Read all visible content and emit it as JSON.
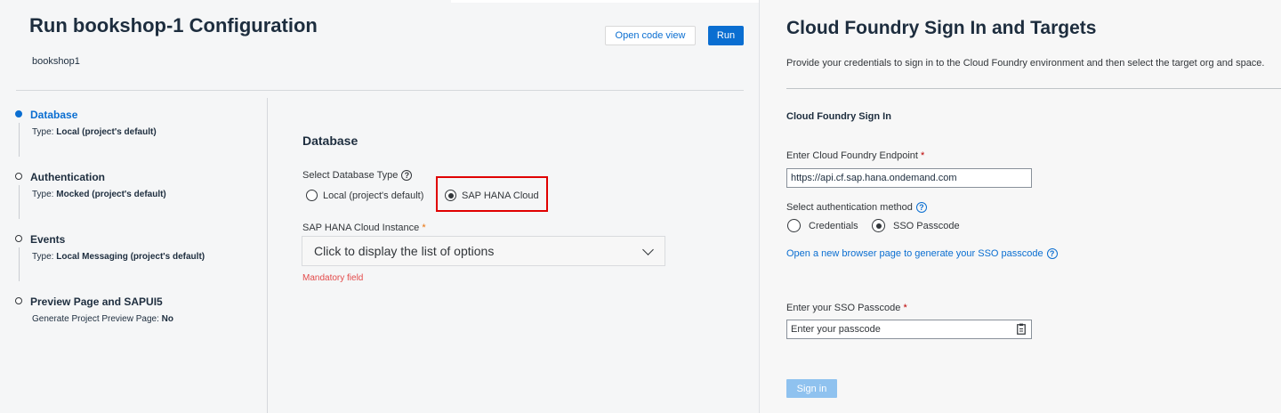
{
  "config": {
    "title": "Run bookshop-1 Configuration",
    "project": "bookshop1",
    "open_code_view_label": "Open code view",
    "run_label": "Run"
  },
  "steps": [
    {
      "title": "Database",
      "sub_label": "Type:",
      "sub_value": "Local (project's default)",
      "active": true
    },
    {
      "title": "Authentication",
      "sub_label": "Type:",
      "sub_value": "Mocked (project's default)",
      "active": false
    },
    {
      "title": "Events",
      "sub_label": "Type:",
      "sub_value": "Local Messaging (project's default)",
      "active": false
    },
    {
      "title": "Preview Page and SAPUI5",
      "sub_label": "Generate Project Preview Page:",
      "sub_value": "No",
      "active": false
    }
  ],
  "database": {
    "section_title": "Database",
    "type_label": "Select Database Type",
    "options": [
      "Local (project's default)",
      "SAP HANA Cloud"
    ],
    "selected_option": "SAP HANA Cloud",
    "instance_label": "SAP HANA Cloud Instance",
    "required_mark": "*",
    "instance_placeholder": "Click to display the list of options",
    "error": "Mandatory field"
  },
  "cf": {
    "title": "Cloud Foundry Sign In and Targets",
    "description": "Provide your credentials to sign in to the Cloud Foundry environment and then select the target org and space.",
    "section": "Cloud Foundry Sign In",
    "endpoint_label": "Enter Cloud Foundry Endpoint",
    "endpoint_value": "https://api.cf.sap.hana.ondemand.com",
    "auth_label": "Select authentication method",
    "auth_options": [
      "Credentials",
      "SSO Passcode"
    ],
    "auth_selected": "SSO Passcode",
    "sso_link": "Open a new browser page to generate your SSO passcode",
    "passcode_label": "Enter your SSO Passcode",
    "passcode_placeholder": "Enter your passcode",
    "signin_label": "Sign in",
    "required_mark": "*"
  },
  "colors": {
    "accent": "#0a6ed1",
    "error": "#e34a4a",
    "highlight": "#e00000"
  }
}
